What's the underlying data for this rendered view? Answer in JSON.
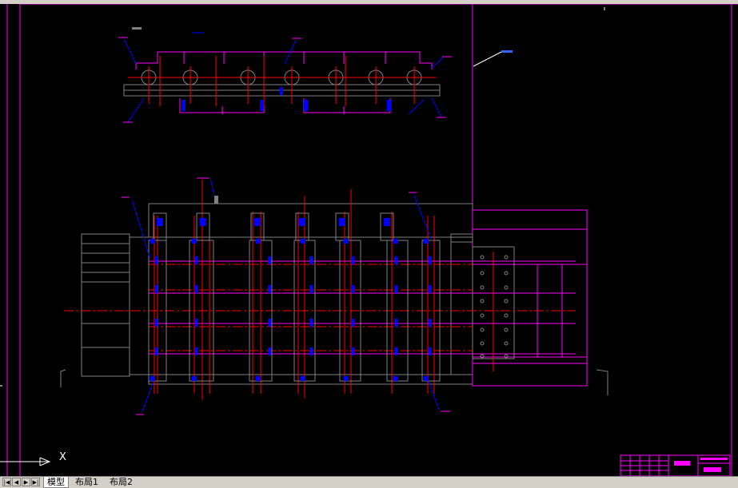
{
  "status_bar": {
    "indicator_icon": "toolbar-strip"
  },
  "ucs": {
    "x_label": "X"
  },
  "tabs": [
    {
      "label": "模型",
      "active": true
    },
    {
      "label": "布局1",
      "active": false
    },
    {
      "label": "布局2",
      "active": false
    }
  ],
  "nav_icons": [
    "first-tab-icon",
    "prev-tab-icon",
    "next-tab-icon",
    "last-tab-icon"
  ],
  "colors": {
    "background": "#000000",
    "magenta": "#ff00ff",
    "red": "#ff0000",
    "blue": "#0000ff",
    "white": "#ffffff",
    "gray": "#808080",
    "chrome": "#d4d0c8"
  }
}
